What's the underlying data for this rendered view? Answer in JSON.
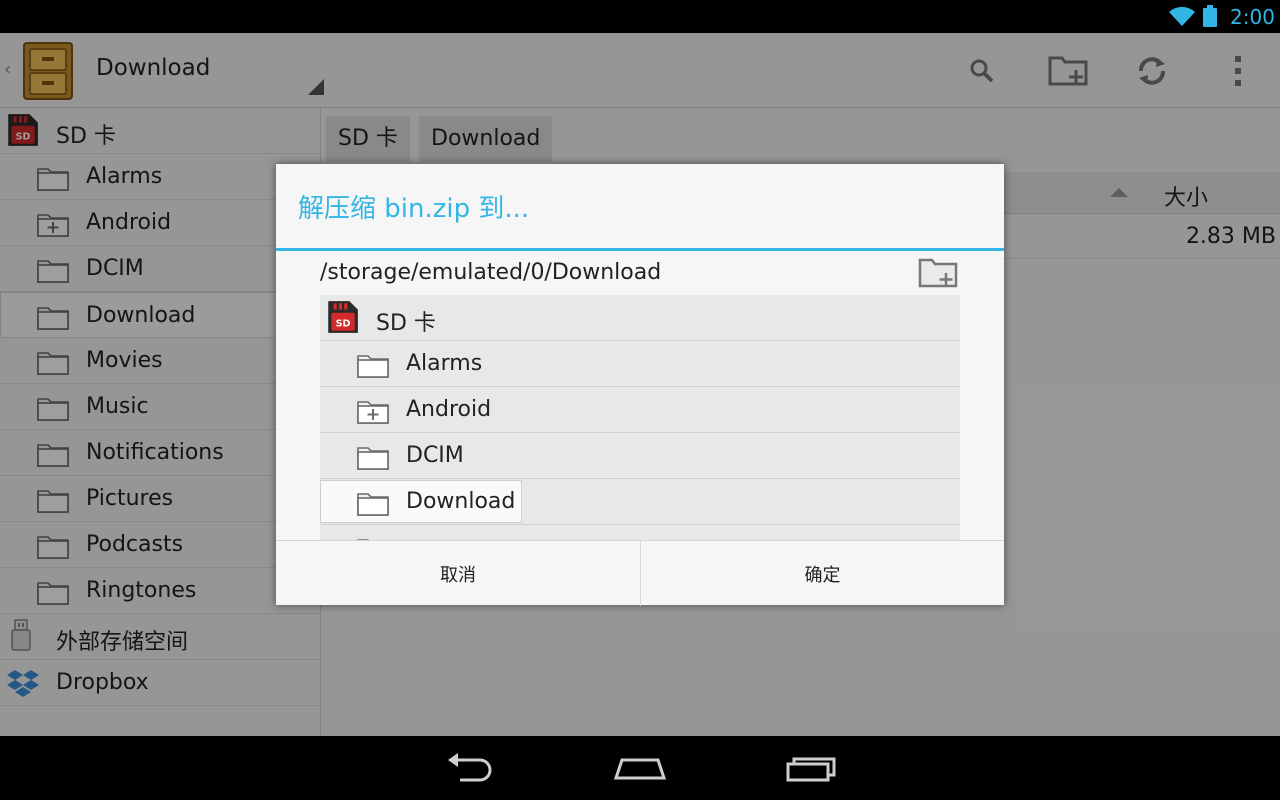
{
  "status_bar": {
    "time": "2:00",
    "wifi_icon": "wifi-icon",
    "battery_icon": "battery-icon"
  },
  "action_bar": {
    "title": "Download",
    "actions": [
      "search-icon",
      "new-folder-icon",
      "refresh-icon",
      "overflow-menu-icon"
    ]
  },
  "sidebar": {
    "items": [
      {
        "label": "SD 卡",
        "icon": "sd-card-icon"
      },
      {
        "label": "Alarms",
        "icon": "folder-icon"
      },
      {
        "label": "Android",
        "icon": "folder-plus-icon"
      },
      {
        "label": "DCIM",
        "icon": "folder-icon"
      },
      {
        "label": "Download",
        "icon": "folder-icon",
        "selected": true
      },
      {
        "label": "Movies",
        "icon": "folder-icon"
      },
      {
        "label": "Music",
        "icon": "folder-icon"
      },
      {
        "label": "Notifications",
        "icon": "folder-icon"
      },
      {
        "label": "Pictures",
        "icon": "folder-icon"
      },
      {
        "label": "Podcasts",
        "icon": "folder-icon"
      },
      {
        "label": "Ringtones",
        "icon": "folder-icon"
      },
      {
        "label": "外部存储空间",
        "icon": "usb-icon"
      },
      {
        "label": "Dropbox",
        "icon": "dropbox-icon"
      }
    ]
  },
  "main": {
    "breadcrumbs": [
      "SD 卡",
      "Download"
    ],
    "column_size_header": "大小",
    "files": [
      {
        "size": "2.83 MB"
      }
    ]
  },
  "dialog": {
    "title": "解压缩 bin.zip 到...",
    "path": "/storage/emulated/0/Download",
    "items": [
      {
        "label": "SD 卡",
        "icon": "sd-card-icon"
      },
      {
        "label": "Alarms",
        "icon": "folder-icon"
      },
      {
        "label": "Android",
        "icon": "folder-plus-icon"
      },
      {
        "label": "DCIM",
        "icon": "folder-icon"
      },
      {
        "label": "Download",
        "icon": "folder-icon",
        "selected": true
      }
    ],
    "cancel_label": "取消",
    "ok_label": "确定"
  },
  "colors": {
    "accent": "#33b5e5",
    "sd_red": "#d32b2b"
  }
}
